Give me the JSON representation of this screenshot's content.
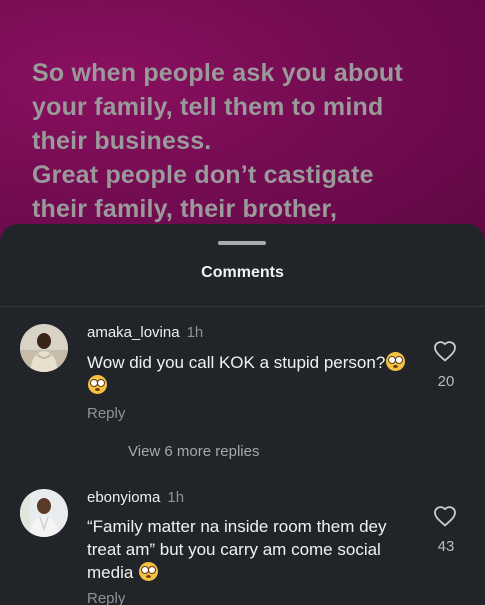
{
  "post": {
    "text": "So when people ask you about\nyour family, tell them to mind\ntheir business.\nGreat people don’t castigate\ntheir family, their brother,"
  },
  "sheet": {
    "title": "Comments"
  },
  "comments": [
    {
      "username": "amaka_lovina",
      "time": "1h",
      "text": "Wow did you call KOK a stupid person?",
      "emoji_count": 2,
      "reply_label": "Reply",
      "likes": "20",
      "view_replies": "View 6 more replies"
    },
    {
      "username": "ebonyioma",
      "time": "1h",
      "text": "“Family matter na inside room them dey treat am” but you carry am come social media",
      "emoji_count": 1,
      "reply_label": "Reply",
      "likes": "43"
    }
  ],
  "colors": {
    "post_background": "#740c52",
    "sheet_background": "#212529",
    "emoji": "#f5c142"
  },
  "icons": {
    "like": "heart-outline-icon",
    "emoji": "flushed-face-emoji"
  }
}
